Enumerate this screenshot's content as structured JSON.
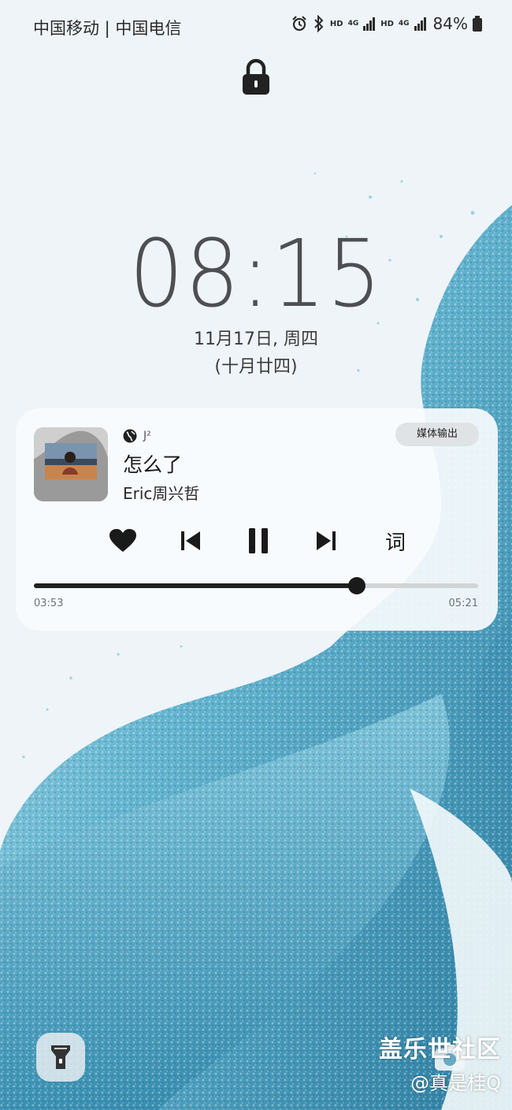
{
  "status_bar": {
    "carrier": "中国移动 | 中国电信",
    "hd_1": "HD",
    "net_1": "4G",
    "hd_2": "HD",
    "net_2": "4G",
    "battery": "84%"
  },
  "lockscreen": {
    "time": "08:15",
    "date": "11月17日, 周四",
    "lunar_date": "(十月廿四)"
  },
  "media_player": {
    "app_label": "J²",
    "song_title": "怎么了",
    "artist": "Eric周兴哲",
    "output_button": "媒体输出",
    "lyrics_button": "词",
    "elapsed": "03:53",
    "total": "05:21",
    "progress": 0.727,
    "icons": [
      "heart-icon",
      "previous-icon",
      "pause-icon",
      "next-icon"
    ]
  },
  "shortcuts": {
    "left": "flashlight-icon",
    "right": "camera-icon"
  },
  "watermark": {
    "line1": "盖乐世社区",
    "line2": "@真是桂Q"
  },
  "colors": {
    "wallpaper_base": "#eef4f8",
    "wave_dark": "#2a6f8f",
    "wave_light": "#9fd3e4",
    "card_bg": "#f8fbfd",
    "text_dark": "#1a1a1a"
  }
}
